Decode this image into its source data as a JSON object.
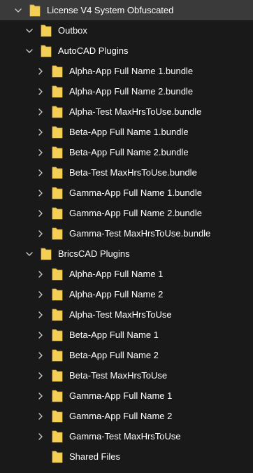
{
  "colors": {
    "background": "#191919",
    "selected_row": "#3a3a3a",
    "folder_fill": "#f4cf56",
    "folder_edge": "#d8a93a",
    "chevron": "#c8c8c8",
    "text": "#ffffff"
  },
  "icons": {
    "expanded": "chevron-down-icon",
    "collapsed": "chevron-right-icon",
    "folder": "folder-icon"
  },
  "tree": {
    "root": {
      "label": "License V4 System Obfuscated",
      "expanded": true
    },
    "outbox": {
      "label": "Outbox",
      "expanded": true
    },
    "autocad": {
      "label": "AutoCAD Plugins",
      "expanded": true,
      "items": [
        "Alpha-App Full Name 1.bundle",
        "Alpha-App Full Name 2.bundle",
        "Alpha-Test MaxHrsToUse.bundle",
        "Beta-App Full Name 1.bundle",
        "Beta-App Full Name 2.bundle",
        "Beta-Test MaxHrsToUse.bundle",
        "Gamma-App Full Name 1.bundle",
        "Gamma-App Full Name 2.bundle",
        "Gamma-Test MaxHrsToUse.bundle"
      ]
    },
    "bricscad": {
      "label": "BricsCAD Plugins",
      "expanded": true,
      "items": [
        "Alpha-App Full Name 1",
        "Alpha-App Full Name 2",
        "Alpha-Test MaxHrsToUse",
        "Beta-App Full Name 1",
        "Beta-App Full Name 2",
        "Beta-Test MaxHrsToUse",
        "Gamma-App Full Name 1",
        "Gamma-App Full Name 2",
        "Gamma-Test MaxHrsToUse"
      ]
    },
    "shared": {
      "label": "Shared Files"
    }
  }
}
